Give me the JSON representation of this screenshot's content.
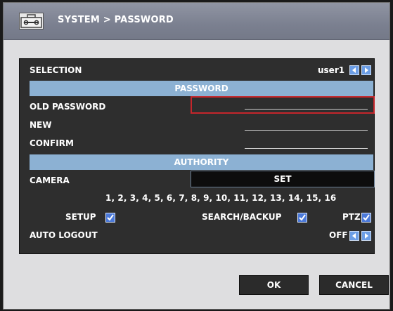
{
  "window": {
    "title": "SYSTEM > PASSWORD"
  },
  "form": {
    "selection_label": "SELECTION",
    "selection_value": "user1",
    "password_section": "PASSWORD",
    "old_password_label": "OLD PASSWORD",
    "new_label": "NEW",
    "confirm_label": "CONFIRM",
    "authority_section": "AUTHORITY",
    "camera_label": "CAMERA",
    "camera_set_label": "SET",
    "camera_list": "1, 2, 3, 4, 5, 6, 7, 8, 9, 10, 11, 12, 13, 14, 15, 16",
    "setup_label": "SETUP",
    "setup_checked": true,
    "search_backup_label": "SEARCH/BACKUP",
    "search_backup_checked": true,
    "ptz_label": "PTZ",
    "ptz_checked": true,
    "auto_logout_label": "AUTO LOGOUT",
    "auto_logout_value": "OFF"
  },
  "buttons": {
    "ok": "OK",
    "cancel": "CANCEL"
  },
  "colors": {
    "section_bar": "#8cb1d3",
    "focus_border": "#c5262b",
    "checkbox": "#4b79d9"
  },
  "icons": {
    "title": "toolbox-icon",
    "prev": "arrow-left-icon",
    "next": "arrow-right-icon",
    "check": "checkmark-icon"
  }
}
